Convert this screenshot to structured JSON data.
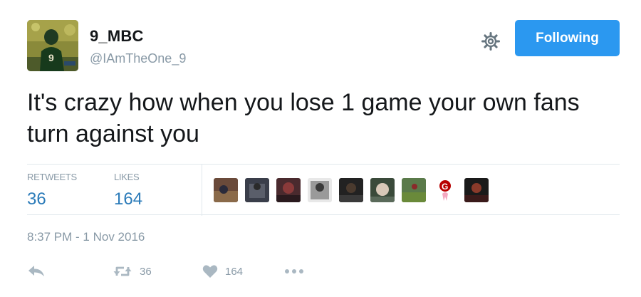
{
  "user": {
    "display_name": "9_MBC",
    "handle": "@IAmTheOne_9",
    "avatar_icon": "user-avatar-photo"
  },
  "header": {
    "settings_icon": "gear-icon",
    "follow_label": "Following",
    "follow_color": "#2b98f0"
  },
  "tweet": {
    "text": "It's crazy how when you lose 1 game your own fans turn against you"
  },
  "stats": {
    "retweets_label": "RETWEETS",
    "retweets_count": "36",
    "likes_label": "LIKES",
    "likes_count": "164",
    "liker_avatars": [
      "liker-avatar",
      "liker-avatar",
      "liker-avatar",
      "liker-avatar",
      "liker-avatar",
      "liker-avatar",
      "liker-avatar",
      "liker-avatar",
      "liker-avatar"
    ]
  },
  "timestamp": "8:37 PM - 1 Nov 2016",
  "actions": {
    "reply_icon": "reply-icon",
    "retweet_icon": "retweet-icon",
    "retweet_count": "36",
    "like_icon": "heart-icon",
    "like_count": "164",
    "more_icon": "more-dots-icon"
  },
  "colors": {
    "link": "#2b7bb9",
    "muted": "#8899a6",
    "border": "#e1e8ed"
  }
}
